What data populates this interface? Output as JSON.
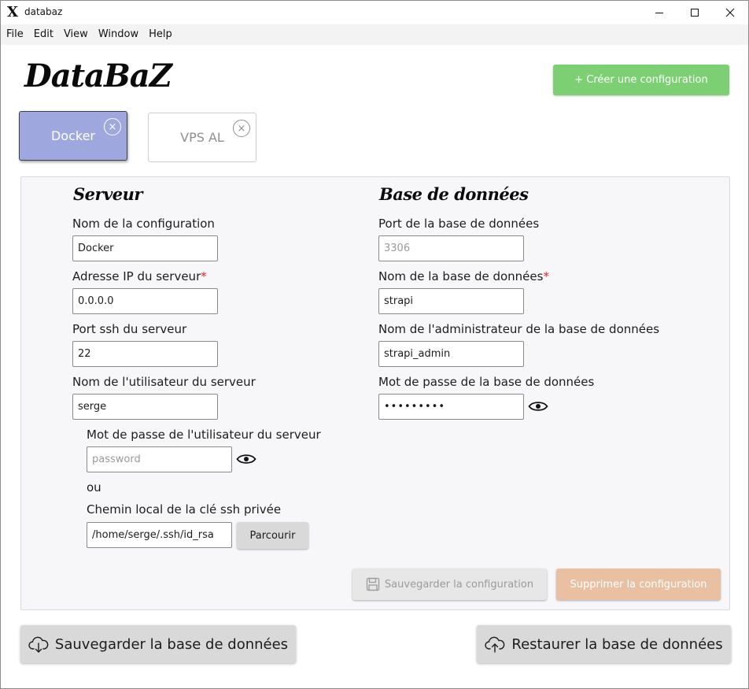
{
  "window": {
    "title": "databaz",
    "app_icon_glyph": "X"
  },
  "menu": [
    "File",
    "Edit",
    "View",
    "Window",
    "Help"
  ],
  "logo": "DataBaZ",
  "create_button": "+ Créer une configuration",
  "tabs": [
    {
      "label": "Docker",
      "active": true,
      "close_glyph": "×"
    },
    {
      "label": "VPS AL",
      "active": false,
      "close_glyph": "×"
    }
  ],
  "server": {
    "title": "Serveur",
    "config_name": {
      "label": "Nom de la configuration",
      "value": "Docker"
    },
    "ip": {
      "label": "Adresse IP du serveur",
      "required": "*",
      "value": "0.0.0.0"
    },
    "ssh_port": {
      "label": "Port ssh du serveur",
      "value": "22"
    },
    "user": {
      "label": "Nom de l'utilisateur du serveur",
      "value": "serge"
    },
    "password": {
      "label": "Mot de passe de l'utilisateur du serveur",
      "placeholder": "password"
    },
    "or_text": "ou",
    "key_path": {
      "label": "Chemin local de la clé ssh privée",
      "value": "/home/serge/.ssh/id_rsa"
    },
    "browse_button": "Parcourir"
  },
  "database": {
    "title": "Base de données",
    "port": {
      "label": "Port de la base de données",
      "placeholder": "3306"
    },
    "name": {
      "label": "Nom de la base de données",
      "required": "*",
      "value": "strapi"
    },
    "admin": {
      "label": "Nom de l'administrateur de la base de données",
      "value": "strapi_admin"
    },
    "password": {
      "label": "Mot de passe de la base de données",
      "value": "•••••••••"
    }
  },
  "save_config_button": "Sauvegarder la configuration",
  "delete_config_button": "Supprimer la configuration",
  "backup_button": "Sauvegarder la base de données",
  "restore_button": "Restaurer la base de données",
  "colors": {
    "accent_green": "#7dcf73",
    "active_tab": "#9ea8df",
    "delete_button": "#e9c0a2",
    "required_marker": "#e02424"
  }
}
